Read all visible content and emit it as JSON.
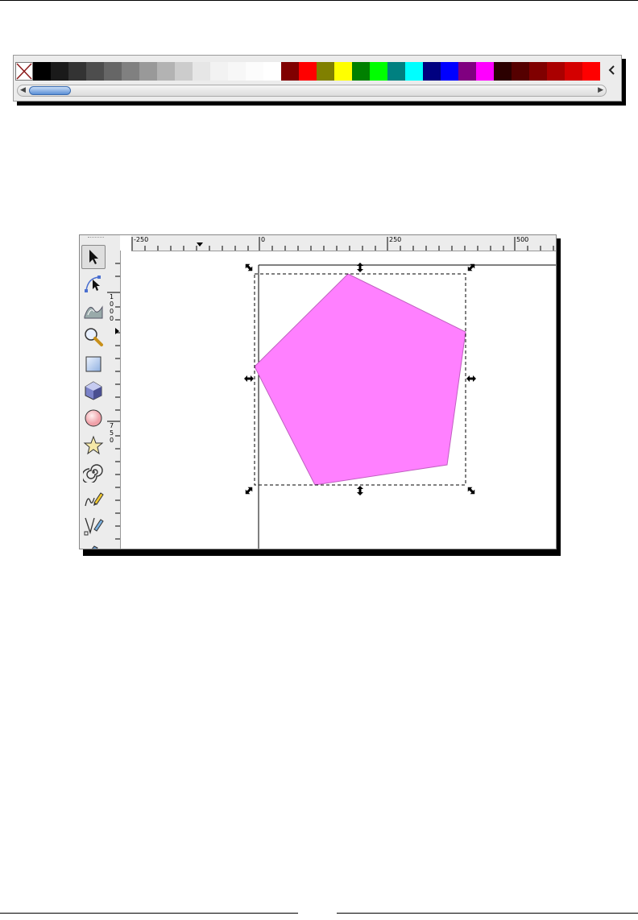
{
  "palette": {
    "none_swatch_icon": "x-mark-icon",
    "menu_icon": "chevron-left-icon",
    "colors": [
      "#000000",
      "#1a1a1a",
      "#333333",
      "#4d4d4d",
      "#666666",
      "#808080",
      "#999999",
      "#b3b3b3",
      "#cccccc",
      "#e6e6e6",
      "#f2f2f2",
      "#f7f7f7",
      "#fcfcfc",
      "#ffffff",
      "#800000",
      "#ff0000",
      "#808000",
      "#ffff00",
      "#008000",
      "#00ff00",
      "#008080",
      "#00ffff",
      "#000080",
      "#0000ff",
      "#800080",
      "#ff00ff",
      "#2b0000",
      "#550000",
      "#800000",
      "#aa0000",
      "#d40000",
      "#ff0000"
    ],
    "scroll_left_icon": "arrow-left-icon",
    "scroll_right_icon": "arrow-right-icon"
  },
  "editor": {
    "ruler_h": [
      "-250",
      "0",
      "250",
      "500"
    ],
    "ruler_v": [
      "1",
      "0",
      "0",
      "0",
      "7",
      "5",
      "0"
    ],
    "tools": [
      {
        "name": "selector-tool",
        "icon": "arrow-pointer-icon"
      },
      {
        "name": "node-tool",
        "icon": "node-editor-icon"
      },
      {
        "name": "tweak-tool",
        "icon": "tweak-icon"
      },
      {
        "name": "zoom-tool",
        "icon": "magnifier-icon"
      },
      {
        "name": "rectangle-tool",
        "icon": "rectangle-icon"
      },
      {
        "name": "3d-box-tool",
        "icon": "3d-box-icon"
      },
      {
        "name": "ellipse-tool",
        "icon": "ellipse-icon"
      },
      {
        "name": "star-tool",
        "icon": "star-icon"
      },
      {
        "name": "spiral-tool",
        "icon": "spiral-icon"
      },
      {
        "name": "pencil-tool",
        "icon": "pencil-icon"
      },
      {
        "name": "pen-tool",
        "icon": "pen-icon"
      }
    ],
    "shape_fill": "#ff80ff",
    "shape_stroke": "#c060c0"
  }
}
